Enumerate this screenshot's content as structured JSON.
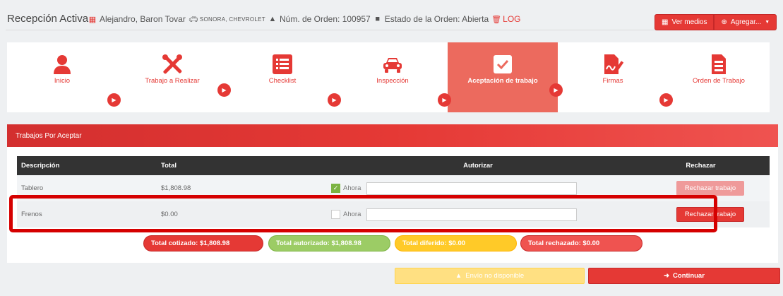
{
  "header": {
    "title": "Recepción Activa",
    "client": "Alejandro, Baron Tovar",
    "vehicle": "SONORA, CHEVROLET",
    "order_number": "Núm. de Orden: 100957",
    "order_status": "Estado de la Orden: Abierta",
    "log": "LOG",
    "ver_medios": "Ver medios",
    "agregar": "Agregar..."
  },
  "steps": [
    {
      "label": "Inicio",
      "icon": "user-icon"
    },
    {
      "label": "Trabajo a Realizar",
      "icon": "tools-icon"
    },
    {
      "label": "Checklist",
      "icon": "checklist-icon"
    },
    {
      "label": "Inspección",
      "icon": "car-icon"
    },
    {
      "label": "Aceptación de trabajo",
      "icon": "check-square-icon",
      "active": true
    },
    {
      "label": "Firmas",
      "icon": "signature-icon"
    },
    {
      "label": "Orden de Trabajo",
      "icon": "document-icon"
    }
  ],
  "panel": {
    "title": "Trabajos Por Aceptar",
    "columns": [
      "Descripción",
      "Total",
      "Autorizar",
      "Rechazar"
    ],
    "rows": [
      {
        "description": "Tablero",
        "total": "$1,808.98",
        "ahora": "Ahora",
        "checked": true,
        "reject": "Rechazar trabajo"
      },
      {
        "description": "Frenos",
        "total": "$0.00",
        "ahora": "Ahora",
        "checked": false,
        "reject": "Rechazar trabajo"
      }
    ]
  },
  "totals": {
    "cotizado": "Total cotizado: $1,808.98",
    "autorizado": "Total autorizado: $1,808.98",
    "diferido": "Total diferido: $0.00",
    "rechazado": "Total rechazado: $0.00"
  },
  "footer": {
    "envio": "Envío no disponible",
    "continuar": "Continuar"
  },
  "colors": {
    "primary": "#e53935",
    "active_step": "#ec6a5e",
    "success": "#9ccc65",
    "warning": "#ffca28",
    "disabled_warning": "#ffe082"
  }
}
